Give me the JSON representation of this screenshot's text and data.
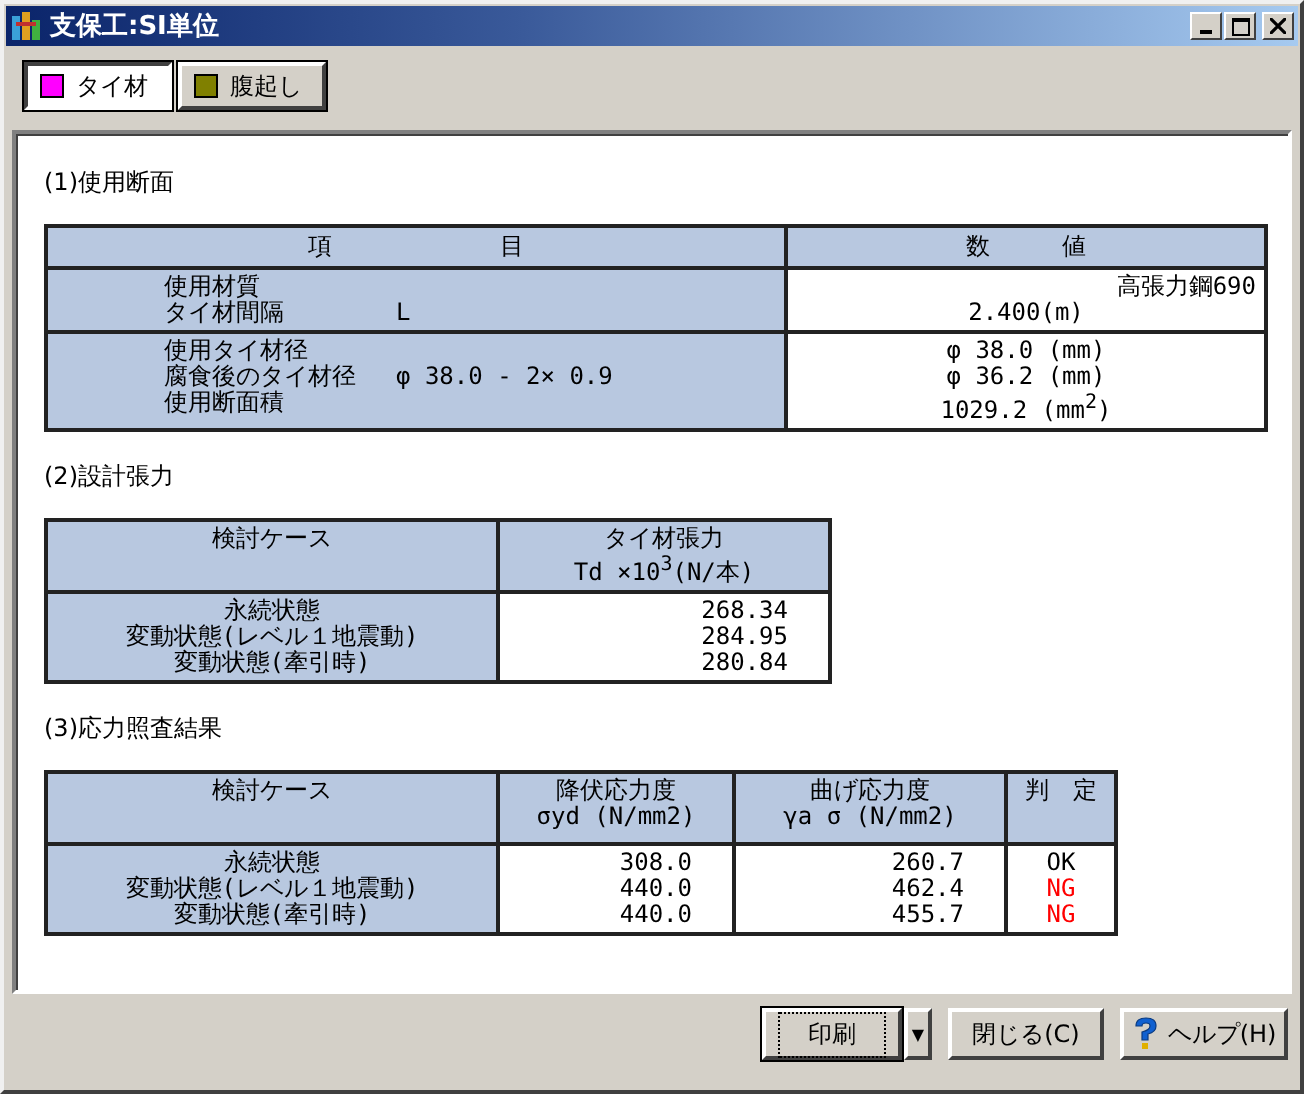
{
  "window": {
    "title": "支保工:SI単位"
  },
  "tabs": [
    {
      "label": "タイ材",
      "color": "#ff00ff",
      "selected": true
    },
    {
      "label": "腹起し",
      "color": "#808000",
      "selected": false
    }
  ],
  "sections": [
    {
      "heading": "(1)使用断面",
      "columns": [
        {
          "lines": [
            "項　　　　　　　目"
          ]
        },
        {
          "lines": [
            "数　　　値"
          ]
        }
      ],
      "rows": [
        {
          "cells": [
            {
              "kind": "items",
              "lines": [
                {
                  "label": "使用材質"
                },
                {
                  "label": "タイ材間隔",
                  "note": "L"
                }
              ]
            },
            {
              "kind": "values",
              "lines": [
                "高張力鋼690",
                "2.400(m)"
              ]
            }
          ]
        },
        {
          "cells": [
            {
              "kind": "items",
              "lines": [
                {
                  "label": "使用タイ材径"
                },
                {
                  "label": "腐食後のタイ材径",
                  "note": "φ 38.0 - 2× 0.9"
                },
                {
                  "label": "使用断面積"
                }
              ]
            },
            {
              "kind": "values",
              "lines": [
                "φ 38.0 (mm)",
                "φ 36.2 (mm)",
                "1029.2 (mm$^{2}$)"
              ]
            }
          ]
        }
      ]
    },
    {
      "heading": "(2)設計張力",
      "columns": [
        {
          "lines": [
            "検討ケース"
          ]
        },
        {
          "lines": [
            "タイ材張力",
            "Td ×10$^{3}$(N/本)"
          ]
        }
      ],
      "rows": [
        {
          "cells": [
            {
              "kind": "label",
              "lines": [
                "永続状態",
                "変動状態(レベル１地震動)",
                "変動状態(牽引時)"
              ]
            },
            {
              "kind": "number",
              "lines": [
                "268.34",
                "284.95",
                "280.84"
              ]
            }
          ]
        }
      ]
    },
    {
      "heading": "(3)応力照査結果",
      "columns": [
        {
          "lines": [
            "検討ケース"
          ]
        },
        {
          "lines": [
            "降伏応力度",
            "σyd (N/mm2)"
          ]
        },
        {
          "lines": [
            "曲げ応力度",
            "γa σ (N/mm2)"
          ]
        },
        {
          "lines": [
            "判　定"
          ]
        }
      ],
      "rows": [
        {
          "cells": [
            {
              "kind": "label",
              "lines": [
                "永続状態",
                "変動状態(レベル１地震動)",
                "変動状態(牽引時)"
              ]
            },
            {
              "kind": "number",
              "lines": [
                "308.0",
                "440.0",
                "440.0"
              ]
            },
            {
              "kind": "number",
              "lines": [
                "260.7",
                "462.4",
                "455.7"
              ]
            },
            {
              "kind": "verdict",
              "lines": [
                {
                  "text": "OK",
                  "fail": false
                },
                {
                  "text": "NG",
                  "fail": true
                },
                {
                  "text": "NG",
                  "fail": true
                }
              ]
            }
          ]
        }
      ]
    }
  ],
  "buttons": [
    {
      "kind": "split",
      "label": "印刷",
      "arrow": "▼"
    },
    {
      "kind": "plain",
      "label": "閉じる(C)"
    },
    {
      "kind": "help",
      "label": "ヘルプ(H)"
    }
  ]
}
